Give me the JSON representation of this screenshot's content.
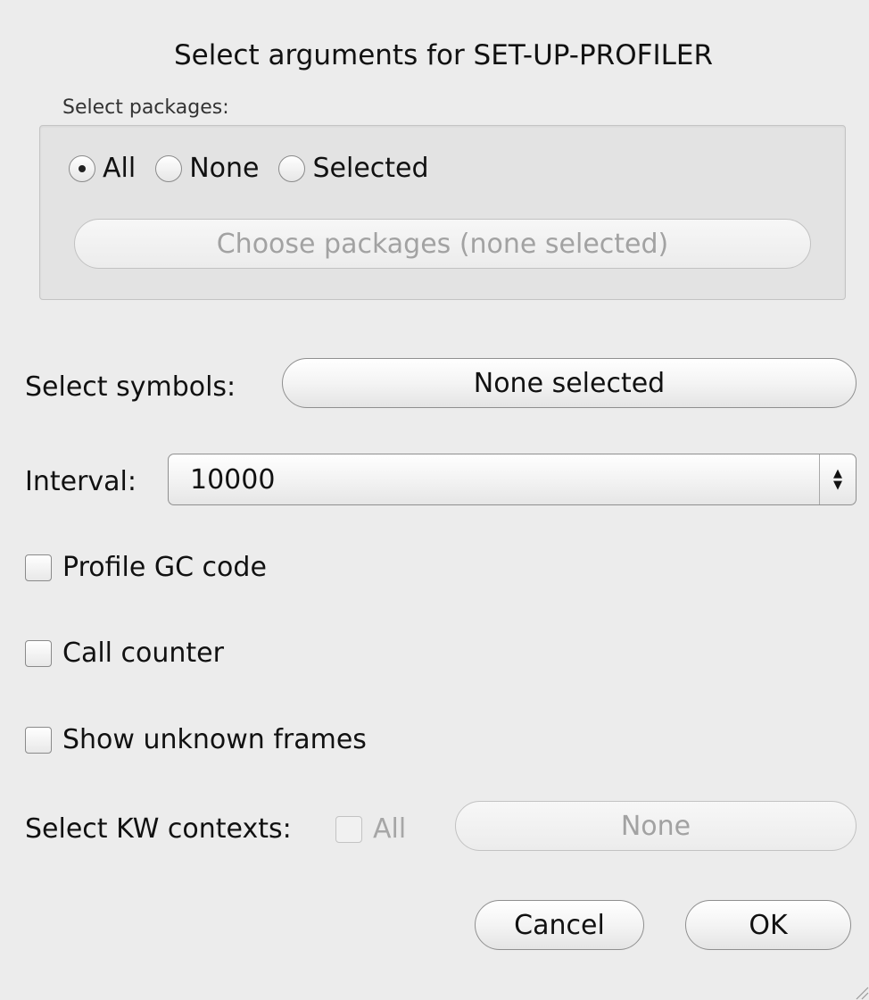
{
  "dialog": {
    "title": "Select arguments for SET-UP-PROFILER"
  },
  "packages": {
    "group_label": "Select packages:",
    "radio_options": [
      {
        "label": "All",
        "selected": true
      },
      {
        "label": "None",
        "selected": false
      },
      {
        "label": "Selected",
        "selected": false
      }
    ],
    "choose_button_label": "Choose packages (none selected)"
  },
  "symbols": {
    "label": "Select symbols:",
    "button_label": "None selected"
  },
  "interval": {
    "label": "Interval:",
    "value": "10000"
  },
  "options": {
    "profile_gc": {
      "label": "Profile GC code",
      "checked": false
    },
    "call_counter": {
      "label": "Call counter",
      "checked": false
    },
    "show_unknown_frames": {
      "label": "Show unknown frames",
      "checked": false
    }
  },
  "kw_contexts": {
    "label": "Select KW contexts:",
    "all_label": "All",
    "button_label": "None"
  },
  "buttons": {
    "cancel": "Cancel",
    "ok": "OK"
  }
}
